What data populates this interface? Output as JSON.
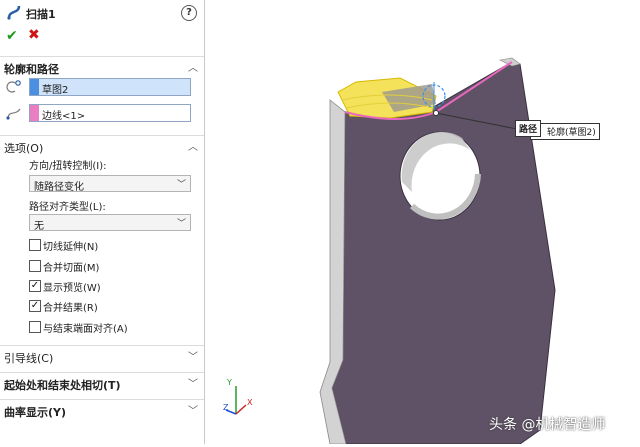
{
  "property_manager": {
    "title": "扫描1",
    "help_icon_label": "?",
    "ok_icon": "checkmark-icon",
    "cancel_icon": "cross-icon",
    "section_profile_path": {
      "label": "轮廓和路径",
      "profile_value": "草图2",
      "path_value": "边线<1>"
    },
    "section_options": {
      "label": "选项(O)",
      "orientation_label": "方向/扭转控制(I):",
      "orientation_value": "随路径变化",
      "path_align_label": "路径对齐类型(L):",
      "path_align_value": "无",
      "checkboxes": [
        {
          "label": "切线延伸(N)",
          "checked": false
        },
        {
          "label": "合并切面(M)",
          "checked": false
        },
        {
          "label": "显示预览(W)",
          "checked": true
        },
        {
          "label": "合并结果(R)",
          "checked": true
        },
        {
          "label": "与结束端面对齐(A)",
          "checked": false
        }
      ]
    },
    "section_guides": {
      "label": "引导线(C)"
    },
    "section_tangency": {
      "label": "起始处和结束处相切(T)"
    },
    "section_curvature": {
      "label": "曲率显示(Y)"
    }
  },
  "viewport": {
    "callout_path": "路径",
    "callout_profile": "轮廓(草图2)",
    "part_color": "#5f5266",
    "triad_labels": [
      "Y",
      "Z",
      "X"
    ]
  },
  "watermark": "头条 @机械智造师"
}
